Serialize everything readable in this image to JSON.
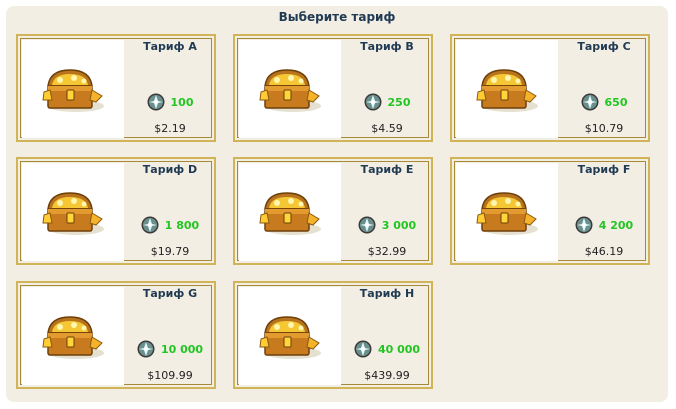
{
  "title": "Выберите тариф",
  "colors": {
    "panel_bg": "#f3eee4",
    "card_border": "#d2b458",
    "amount_text": "#22c522",
    "title_text": "#1f3a52"
  },
  "tariffs": [
    {
      "name": "Тариф A",
      "amount": "100",
      "price": "$2.19",
      "icon": "treasure-chest-icon",
      "currency_icon": "gem-icon"
    },
    {
      "name": "Тариф B",
      "amount": "250",
      "price": "$4.59",
      "icon": "treasure-chest-icon",
      "currency_icon": "gem-icon"
    },
    {
      "name": "Тариф C",
      "amount": "650",
      "price": "$10.79",
      "icon": "treasure-chest-icon",
      "currency_icon": "gem-icon"
    },
    {
      "name": "Тариф D",
      "amount": "1 800",
      "price": "$19.79",
      "icon": "treasure-chest-icon",
      "currency_icon": "gem-icon"
    },
    {
      "name": "Тариф E",
      "amount": "3 000",
      "price": "$32.99",
      "icon": "treasure-chest-icon",
      "currency_icon": "gem-icon"
    },
    {
      "name": "Тариф F",
      "amount": "4 200",
      "price": "$46.19",
      "icon": "treasure-chest-icon",
      "currency_icon": "gem-icon"
    },
    {
      "name": "Тариф G",
      "amount": "10 000",
      "price": "$109.99",
      "icon": "treasure-chest-icon",
      "currency_icon": "gem-icon"
    },
    {
      "name": "Тариф H",
      "amount": "40 000",
      "price": "$439.99",
      "icon": "treasure-chest-icon",
      "currency_icon": "gem-icon"
    }
  ]
}
